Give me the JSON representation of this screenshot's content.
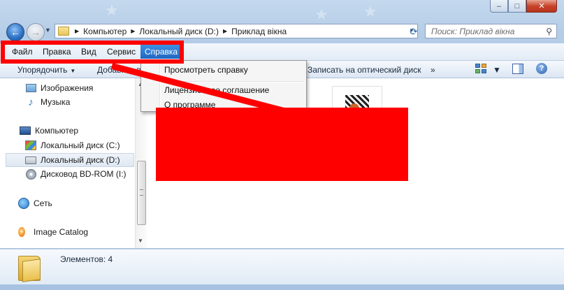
{
  "window": {
    "controls": {
      "minimize": "–",
      "maximize": "□",
      "close": "✕"
    }
  },
  "navigation": {
    "back_icon": "back-arrow-icon",
    "forward_icon": "forward-arrow-icon",
    "address": {
      "crumbs": [
        "Компьютер",
        "Локальный диск (D:)",
        "Приклад вікна"
      ]
    },
    "search": {
      "placeholder": "Поиск: Приклад вікна"
    }
  },
  "menu_bar": {
    "items": [
      "Файл",
      "Правка",
      "Вид",
      "Сервис",
      "Справка"
    ],
    "active": "Справка",
    "highlight_color": "#ff0000"
  },
  "help_menu": {
    "items": [
      "Просмотреть справку",
      "Лицензионное соглашение",
      "О программе"
    ]
  },
  "toolbar": {
    "organize": "Упорядочить",
    "add_partial": "Добавить в",
    "burn": "Записать на оптический диск",
    "more": "»"
  },
  "nav_pane": {
    "items": [
      {
        "label": "Изображения",
        "icon": "pictures-icon"
      },
      {
        "label": "Музыка",
        "icon": "music-icon"
      },
      {
        "label": "Компьютер",
        "icon": "computer-icon"
      },
      {
        "label": "Локальный диск (C:)",
        "icon": "system-drive-icon"
      },
      {
        "label": "Локальный диск (D:)",
        "icon": "drive-icon",
        "selected": true
      },
      {
        "label": "Дисковод BD-ROM (I:)",
        "icon": "bd-rom-icon"
      },
      {
        "label": "Сеть",
        "icon": "network-icon"
      },
      {
        "label": "Image Catalog",
        "icon": "image-catalog-icon"
      }
    ]
  },
  "status_bar": {
    "items_count": "Элементов: 4"
  },
  "colors": {
    "accent": "#2166c2",
    "annotation": "#ff0000"
  }
}
